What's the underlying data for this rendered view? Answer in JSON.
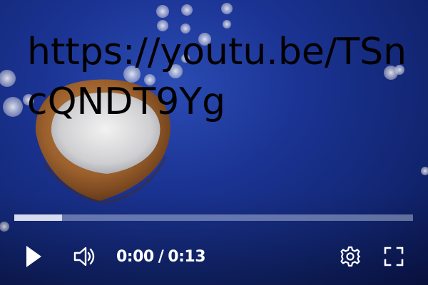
{
  "overlay": {
    "url_text": "https://youtu.be/TSncQNDT9Yg"
  },
  "player": {
    "current_time": "0:00",
    "time_separator": "/",
    "duration": "0:13",
    "progress_fraction": 0.12
  },
  "icons": {
    "play": "play-icon",
    "volume": "volume-icon",
    "settings": "gear-icon",
    "fullscreen": "fullscreen-icon"
  },
  "colors": {
    "background_blue": "#1b3494",
    "control_white": "#ffffff",
    "overlay_text": "#000000"
  }
}
